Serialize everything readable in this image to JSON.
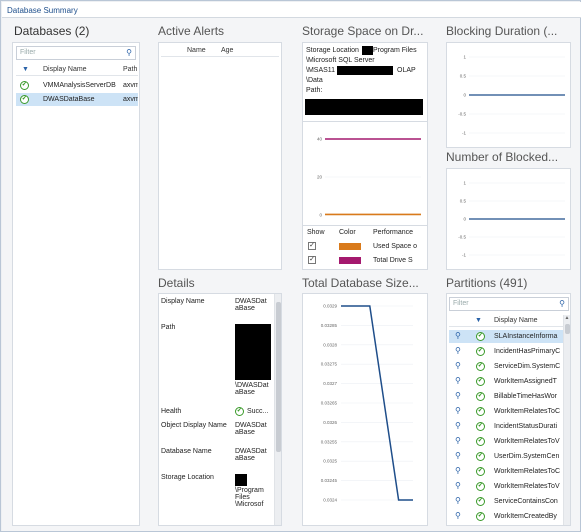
{
  "window_title": "Database Summary",
  "databases": {
    "title": "Databases (2)",
    "filter_placeholder": "Filter",
    "columns": [
      "Display Name",
      "Path"
    ],
    "rows": [
      {
        "name": "VMMAnalysisServerDB",
        "path": "axvm"
      },
      {
        "name": "DWASDataBase",
        "path": "axvm"
      }
    ]
  },
  "active_alerts": {
    "title": "Active Alerts",
    "columns": [
      "Name",
      "Age"
    ]
  },
  "storage": {
    "title": "Storage Space on Dr...",
    "location_line1": "Storage Location",
    "location_line1b": "Program Files",
    "location_line2": "\\Microsoft SQL Server",
    "location_line3": "\\MSAS11",
    "location_line3b": "OLAP",
    "location_line4": "\\Data",
    "path_label": "Path:",
    "legend_cols": [
      "Show",
      "Color",
      "Performance"
    ],
    "legend_rows": [
      {
        "label": "Used Space o",
        "color": "#d97a1b"
      },
      {
        "label": "Total Drive S",
        "color": "#a4196e"
      }
    ]
  },
  "blocking_duration": {
    "title": "Blocking Duration (..."
  },
  "number_blocked": {
    "title": "Number of Blocked..."
  },
  "details": {
    "title": "Details",
    "rows": [
      {
        "label": "Display Name",
        "value": "DWASDat aBase"
      },
      {
        "label": "Path",
        "value": "\\DWASDat aBase"
      },
      {
        "label": "Health",
        "value": "Succ..."
      },
      {
        "label": "Object Display Name",
        "value": "DWASDat aBase"
      },
      {
        "label": "Database Name",
        "value": "DWASDat aBase"
      },
      {
        "label": "Storage Location",
        "value": "\\Program Files \\Microsof"
      }
    ]
  },
  "total_db_size": {
    "title": "Total Database Size..."
  },
  "partitions": {
    "title": "Partitions (491)",
    "filter_placeholder": "Filter",
    "column": "Display Name",
    "rows": [
      "SLAInstanceInforma",
      "IncidentHasPrimaryC",
      "ServiceDim.SystemC",
      "WorkItemAssignedT",
      "BillableTimeHasWor",
      "WorkItemRelatesToC",
      "IncidentStatusDurati",
      "WorkItemRelatesToV",
      "UserDim.SystemCen",
      "WorkItemRelatesToC",
      "WorkItemRelatesToV",
      "ServiceContainsCon",
      "WorkItemCreatedBy"
    ]
  },
  "chart_data": [
    {
      "type": "line",
      "title": "Storage Space on Dr...",
      "x": [
        0,
        1,
        2,
        3,
        4,
        5
      ],
      "ylim": [
        0,
        40
      ],
      "yticks": [
        0,
        20,
        40
      ],
      "series": [
        {
          "name": "Total Drive S",
          "color": "#a4196e",
          "values": [
            40,
            40,
            40,
            40,
            40,
            40
          ]
        },
        {
          "name": "Used Space o",
          "color": "#d97a1b",
          "values": [
            0.3,
            0.3,
            0.3,
            0.3,
            0.3,
            0.3
          ]
        }
      ]
    },
    {
      "type": "line",
      "title": "Blocking Duration (...",
      "ylim": [
        -1,
        1
      ],
      "yticks": [
        1,
        0.5,
        0,
        -0.5,
        -1
      ],
      "x": [
        0,
        1,
        2,
        3,
        4,
        5
      ],
      "series": [
        {
          "color": "#1f4e8a",
          "values": [
            0,
            0,
            0,
            0,
            0,
            0
          ]
        }
      ]
    },
    {
      "type": "line",
      "title": "Number of Blocked...",
      "ylim": [
        -1,
        1
      ],
      "yticks": [
        1,
        0.5,
        0,
        -0.5,
        -1
      ],
      "x": [
        0,
        1,
        2,
        3,
        4,
        5
      ],
      "series": [
        {
          "color": "#1f4e8a",
          "values": [
            0,
            0,
            0,
            0,
            0,
            0
          ]
        }
      ]
    },
    {
      "type": "line",
      "title": "Total Database Size...",
      "ylim": [
        0.0324,
        0.0329
      ],
      "yticks": [
        0.0329,
        0.03285,
        0.0328,
        0.03275,
        0.0327,
        0.03265,
        0.0326,
        0.03255,
        0.0325,
        0.03245,
        0.0324
      ],
      "x": [
        0,
        1,
        2,
        3,
        4,
        5,
        6,
        7,
        8,
        9,
        10
      ],
      "series": [
        {
          "color": "#1f4e8a",
          "values": [
            0.0329,
            0.0329,
            0.0329,
            0.0329,
            0.0329,
            null,
            null,
            null,
            0.0324,
            0.0324,
            0.0324
          ]
        }
      ]
    }
  ]
}
